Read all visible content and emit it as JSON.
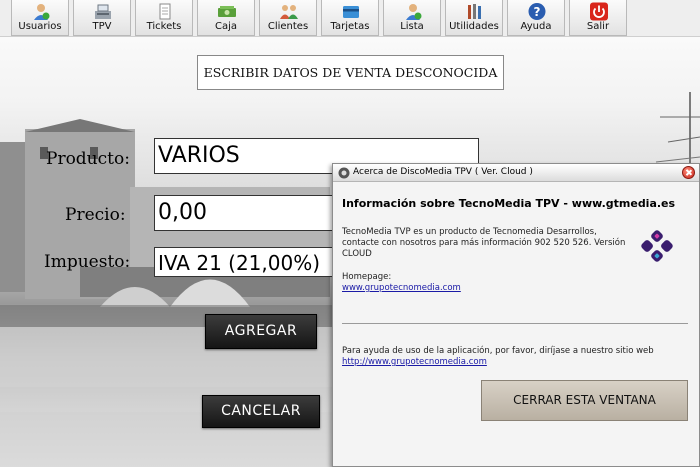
{
  "toolbar": {
    "items": [
      {
        "label": "Usuarios",
        "icon": "users-icon"
      },
      {
        "label": "TPV",
        "icon": "cash-register-icon"
      },
      {
        "label": "Tickets",
        "icon": "tickets-icon"
      },
      {
        "label": "Caja",
        "icon": "cash-box-icon"
      },
      {
        "label": "Clientes",
        "icon": "clients-icon"
      },
      {
        "label": "Tarjetas",
        "icon": "cards-icon"
      },
      {
        "label": "Lista",
        "icon": "list-user-icon"
      },
      {
        "label": "Utilidades",
        "icon": "utilities-icon"
      },
      {
        "label": "Ayuda",
        "icon": "help-icon"
      },
      {
        "label": "Salir",
        "icon": "power-icon"
      }
    ]
  },
  "form": {
    "title": "ESCRIBIR DATOS DE VENTA DESCONOCIDA",
    "producto_label": "Producto:",
    "producto_value": "VARIOS",
    "precio_label": "Precio:",
    "precio_value": "0,00",
    "impuesto_label": "Impuesto:",
    "impuesto_value": "IVA 21 (21,00%)",
    "agregar_label": "AGREGAR",
    "cancelar_label": "CANCELAR"
  },
  "dialog": {
    "title": "Acerca de DiscoMedia TPV ( Ver. Cloud )",
    "heading": "Información sobre TecnoMedia TPV - www.gtmedia.es",
    "desc_line1": "TecnoMedia TVP es un producto de Tecnomedia Desarrollos,",
    "desc_line2": "contacte con nosotros para más información 902 520 526. Versión",
    "desc_line3": "CLOUD",
    "homepage_label": "Homepage:",
    "homepage_link": "www.grupotecnomedia.com",
    "help_text": "Para ayuda de uso de la aplicación, por favor, diríjase a nuestro sitio web",
    "help_link": "http://www.grupotecnomedia.com",
    "close_button": "CERRAR ESTA VENTANA"
  },
  "colors": {
    "dark_button": "#1f1f1f",
    "link": "#1a1aa6",
    "power_red": "#d9261c",
    "help_blue": "#2a5db0"
  }
}
